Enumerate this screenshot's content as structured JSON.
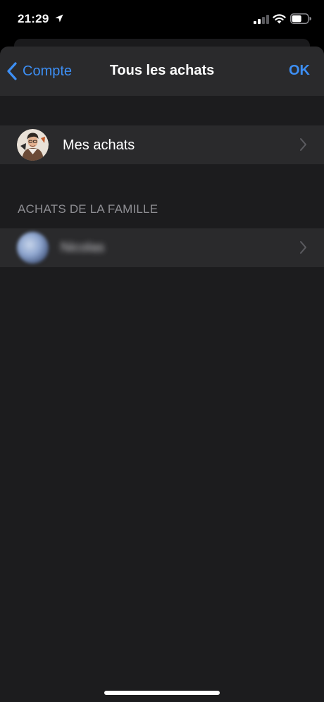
{
  "status_bar": {
    "time": "21:29",
    "icons": [
      "location-arrow-icon",
      "cellular-signal-icon",
      "wifi-icon",
      "battery-icon"
    ],
    "battery_level": 0.6
  },
  "nav": {
    "back_label": "Compte",
    "title": "Tous les achats",
    "done_label": "OK"
  },
  "my_purchases": {
    "label": "Mes achats",
    "avatar_icon": "profile-avatar-icon"
  },
  "family_section": {
    "header": "ACHATS DE LA FAMILLE",
    "members": [
      {
        "name": "Nicolas",
        "blurred": true
      }
    ]
  },
  "colors": {
    "accent": "#3d8ff5",
    "sheet_background": "#1c1c1e",
    "cell_background": "#2a2a2c",
    "secondary_text": "#8e8e93",
    "chevron": "#5b5b60"
  }
}
